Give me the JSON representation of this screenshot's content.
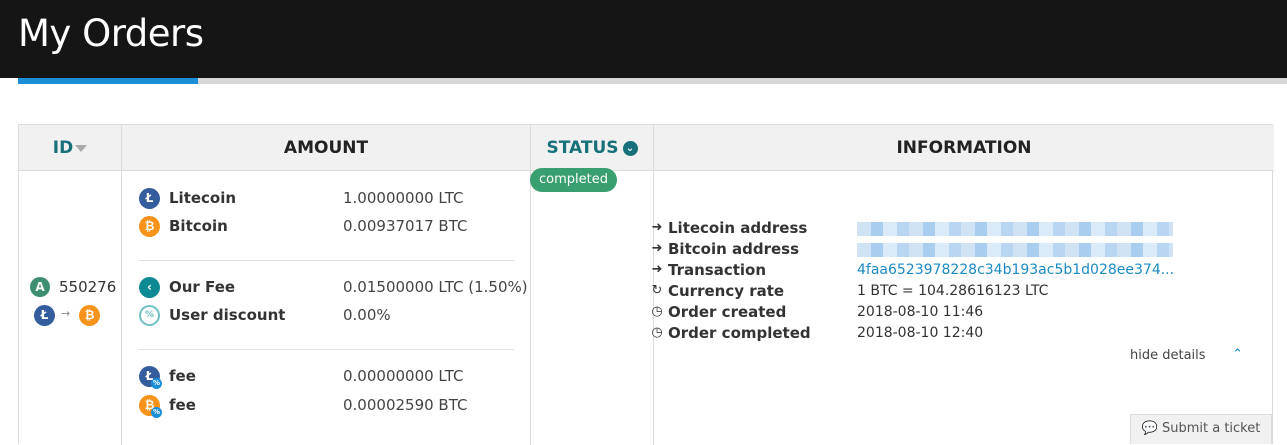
{
  "page": {
    "title": "My Orders"
  },
  "table": {
    "headers": {
      "id": "ID",
      "amount": "AMOUNT",
      "status": "STATUS",
      "information": "INFORMATION"
    }
  },
  "order": {
    "id": "550276",
    "id_badge": "A",
    "pair_from_icon": "litecoin-icon",
    "pair_to_icon": "bitcoin-icon",
    "amounts": [
      {
        "icon": "litecoin-icon",
        "label": "Litecoin",
        "value": "1.00000000 LTC"
      },
      {
        "icon": "bitcoin-icon",
        "label": "Bitcoin",
        "value": "0.00937017 BTC"
      }
    ],
    "fees": [
      {
        "icon": "fee-icon",
        "label": "Our Fee",
        "value": "0.01500000 LTC (1.50%)"
      },
      {
        "icon": "discount-icon",
        "label": "User discount",
        "value": "0.00%"
      }
    ],
    "network_fees": [
      {
        "icon": "litecoin-fee-icon",
        "label": "fee",
        "value": "0.00000000 LTC"
      },
      {
        "icon": "bitcoin-fee-icon",
        "label": "fee",
        "value": "0.00002590 BTC"
      }
    ],
    "status": "completed",
    "status_color": "#3a9f6f",
    "information": {
      "litecoin_address_label": "Litecoin address",
      "bitcoin_address_label": "Bitcoin address",
      "transaction_label": "Transaction",
      "transaction_value": "4faa6523978228c34b193ac5b1d028ee374...",
      "currency_rate_label": "Currency rate",
      "currency_rate_value": "1 BTC = 104.28616123 LTC",
      "order_created_label": "Order created",
      "order_created_value": "2018-08-10 11:46",
      "order_completed_label": "Order completed",
      "order_completed_value": "2018-08-10 12:40"
    },
    "hide_details": "hide details"
  },
  "footer": {
    "ticket_label": "Submit a ticket"
  },
  "colors": {
    "accent": "#1b8ed8",
    "teal": "#17707a",
    "link": "#1a8bc4"
  }
}
